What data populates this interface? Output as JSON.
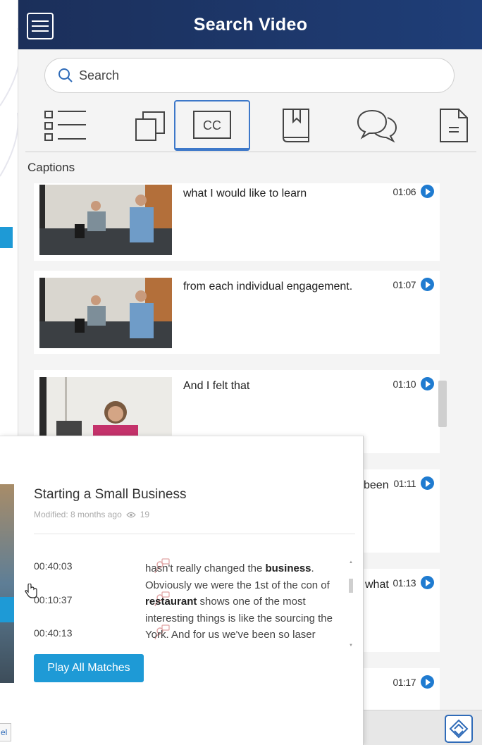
{
  "header": {
    "title": "Search Video"
  },
  "search": {
    "placeholder": "Search"
  },
  "tabs": [
    {
      "icon": "list-icon"
    },
    {
      "icon": "copy-icon"
    },
    {
      "icon": "closed-caption-icon",
      "label": "CC",
      "active": true
    },
    {
      "icon": "bookmark-icon"
    },
    {
      "icon": "chat-icon"
    },
    {
      "icon": "document-icon"
    }
  ],
  "section": {
    "label": "Captions"
  },
  "captions": [
    {
      "text": "what I would like to learn",
      "time": "01:06",
      "thumb": "office-two-men"
    },
    {
      "text": "from each individual engagement.",
      "time": "01:07",
      "thumb": "office-two-men"
    },
    {
      "text": "And I felt that",
      "time": "01:10",
      "thumb": "woman-smiling"
    },
    {
      "text": "been",
      "time": "01:11",
      "thumb": ""
    },
    {
      "text": "what",
      "time": "01:13",
      "thumb": ""
    },
    {
      "text": "",
      "time": "01:17",
      "thumb": ""
    }
  ],
  "popup": {
    "title": "Starting a Small Business",
    "modified": "Modified: 8 months ago",
    "views": "19",
    "matches": [
      {
        "time": "00:40:03"
      },
      {
        "time": "00:10:37"
      },
      {
        "time": "00:40:13"
      }
    ],
    "transcript": {
      "line1_pre": "hasn't really changed the ",
      "line1_bold": "business",
      "line1_post": ".",
      "line2": "Obviously we were the 1st of the con of",
      "line3_bold": "restaurant",
      "line3_post": " shows one of the most",
      "line4": "interesting things is like the sourcing the",
      "line5": "York. And for us we've been so laser"
    },
    "play_all_label": "Play All Matches",
    "corner_label": "el"
  },
  "colors": {
    "header": "#1f3e78",
    "accent": "#1e9ad6",
    "play": "#1f7bd0",
    "active_tab": "#3d78c9"
  }
}
